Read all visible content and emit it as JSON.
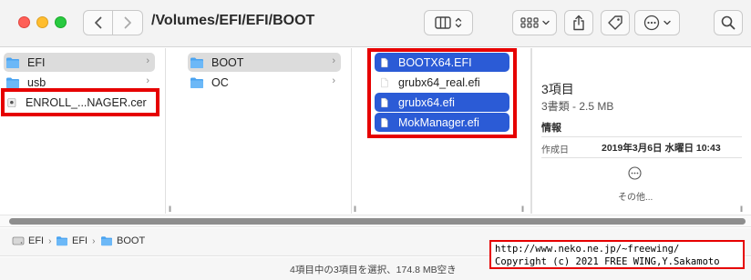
{
  "window": {
    "title": "/Volumes/EFI/EFI/BOOT"
  },
  "icons": {
    "back": "chevron-left-icon",
    "forward": "chevron-right-icon",
    "view": "columns-view-icon",
    "group": "grid-group-icon",
    "share": "share-icon",
    "tag": "tag-icon",
    "action": "ellipsis-circle-icon",
    "search": "search-icon"
  },
  "colors": {
    "selection_blue": "#2b5bd6",
    "selection_grey": "#dcdcdc",
    "annotation_red": "#e60000",
    "folder_blue": "#4aa3f0"
  },
  "column1": {
    "items": [
      {
        "label": "EFI",
        "selected": "grey",
        "chevron": "›"
      },
      {
        "label": "usb",
        "chevron": "›"
      },
      {
        "label": "ENROLL_...NAGER.cer"
      }
    ]
  },
  "column2": {
    "items": [
      {
        "label": "BOOT",
        "selected": "grey",
        "chevron": "›"
      },
      {
        "label": "OC",
        "chevron": "›"
      }
    ]
  },
  "column3": {
    "items": [
      {
        "label": "BOOTX64.EFI",
        "selected": "blue"
      },
      {
        "label": "grubx64_real.efi"
      },
      {
        "label": "grubx64.efi",
        "selected": "blue"
      },
      {
        "label": "MokManager.efi",
        "selected": "blue"
      }
    ]
  },
  "preview": {
    "title": "3項目",
    "subtitle": "3書類 - 2.5 MB",
    "info_heading": "情報",
    "created_label": "作成日",
    "created_value": "2019年3月6日 水曜日 10:43",
    "more_label": "その他..."
  },
  "pathbar": {
    "crumbs": [
      {
        "label": "EFI",
        "sep": "›"
      },
      {
        "label": "EFI",
        "sep": "›"
      },
      {
        "label": "BOOT"
      }
    ]
  },
  "status": {
    "text": "4項目中の3項目を選択、174.8 MB空き"
  },
  "copyright": {
    "line1": "http://www.neko.ne.jp/~freewing/",
    "line2": "Copyright (c) 2021 FREE WING,Y.Sakamoto"
  },
  "column_handle": "ll"
}
